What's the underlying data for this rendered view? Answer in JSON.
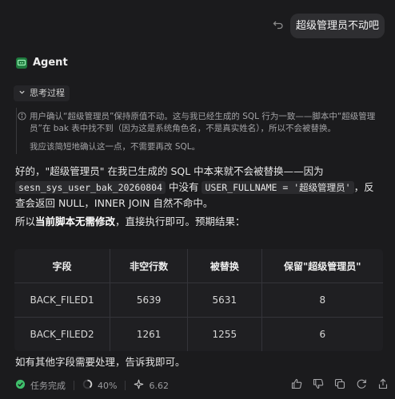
{
  "user_message": "超级管理员不动吧",
  "agent": {
    "name": "Agent"
  },
  "thinking": {
    "toggle_label": "思考过程",
    "line1": "用户确认“超级管理员”保持原值不动。这与我已经生成的 SQL 行为一致——脚本中“超级管理员”在 bak 表中找不到（因为这是系统角色名，不是真实姓名），所以不会被替换。",
    "line2": "我应该简短地确认这一点，不需要再改 SQL。"
  },
  "answer": {
    "p1_a": "好的，",
    "p1_b": "\"超级管理员\"",
    "p1_c": " 在我已生成的 SQL 中本来就不会被替换——因为 ",
    "p1_code1": "sesn_sys_user_bak_20260804",
    "p1_d": " 中没有 ",
    "p1_code2": "USER_FULLNAME = '超级管理员'",
    "p1_e": "，反查会返回 NULL，INNER JOIN 自然不命中。",
    "p2_a": "所以",
    "p2_b": "当前脚本无需修改",
    "p2_c": "，直接执行即可。预期结果：",
    "p3": "如有其他字段需要处理，告诉我即可。"
  },
  "table": {
    "headers": [
      "字段",
      "非空行数",
      "被替换",
      "保留\"超级管理员\""
    ],
    "rows": [
      [
        "BACK_FILED1",
        "5639",
        "5631",
        "8"
      ],
      [
        "BACK_FILED2",
        "1261",
        "1255",
        "6"
      ]
    ]
  },
  "status": {
    "task": "任务完成",
    "progress": "40%",
    "score": "6.62"
  },
  "colors": {
    "accent_green": "#22c55e",
    "status_green": "#3fbf6b"
  }
}
